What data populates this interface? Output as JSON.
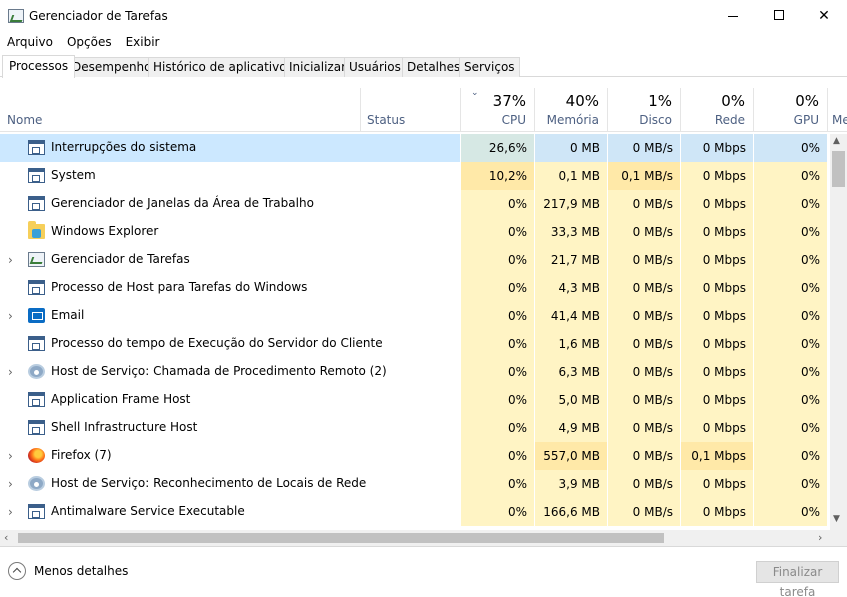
{
  "window": {
    "title": "Gerenciador de Tarefas",
    "min": "—",
    "max": "□",
    "close": "✕"
  },
  "menu": [
    "Arquivo",
    "Opções",
    "Exibir"
  ],
  "tabs": [
    "Processos",
    "Desempenho",
    "Histórico de aplicativos",
    "Inicializar",
    "Usuários",
    "Detalhes",
    "Serviços"
  ],
  "active_tab": "Processos",
  "columns": {
    "name": "Nome",
    "status": "Status",
    "cpu": {
      "pct": "37%",
      "label": "CPU"
    },
    "memory": {
      "pct": "40%",
      "label": "Memória"
    },
    "disk": {
      "pct": "1%",
      "label": "Disco"
    },
    "network": {
      "pct": "0%",
      "label": "Rede"
    },
    "gpu": {
      "pct": "0%",
      "label": "GPU"
    },
    "more": "Me"
  },
  "sort_indicator": "⌄",
  "processes": [
    {
      "name": "Interrupções do sistema",
      "icon": "window-icon",
      "expandable": false,
      "cpu": "26,6%",
      "memory": "0 MB",
      "disk": "0 MB/s",
      "network": "0 Mbps",
      "gpu": "0%"
    },
    {
      "name": "System",
      "icon": "window-icon",
      "expandable": false,
      "cpu": "10,2%",
      "memory": "0,1 MB",
      "disk": "0,1 MB/s",
      "network": "0 Mbps",
      "gpu": "0%"
    },
    {
      "name": "Gerenciador de Janelas da Área de Trabalho",
      "icon": "window-icon",
      "expandable": false,
      "cpu": "0%",
      "memory": "217,9 MB",
      "disk": "0 MB/s",
      "network": "0 Mbps",
      "gpu": "0%"
    },
    {
      "name": "Windows Explorer",
      "icon": "folder-icon",
      "expandable": false,
      "cpu": "0%",
      "memory": "33,3 MB",
      "disk": "0 MB/s",
      "network": "0 Mbps",
      "gpu": "0%"
    },
    {
      "name": "Gerenciador de Tarefas",
      "icon": "task-manager-icon",
      "expandable": true,
      "cpu": "0%",
      "memory": "21,7 MB",
      "disk": "0 MB/s",
      "network": "0 Mbps",
      "gpu": "0%"
    },
    {
      "name": "Processo de Host para Tarefas do Windows",
      "icon": "window-icon",
      "expandable": false,
      "cpu": "0%",
      "memory": "4,3 MB",
      "disk": "0 MB/s",
      "network": "0 Mbps",
      "gpu": "0%"
    },
    {
      "name": "Email",
      "icon": "mail-icon",
      "expandable": true,
      "cpu": "0%",
      "memory": "41,4 MB",
      "disk": "0 MB/s",
      "network": "0 Mbps",
      "gpu": "0%"
    },
    {
      "name": "Processo do tempo de Execução do Servidor do Cliente",
      "icon": "window-icon",
      "expandable": false,
      "cpu": "0%",
      "memory": "1,6 MB",
      "disk": "0 MB/s",
      "network": "0 Mbps",
      "gpu": "0%"
    },
    {
      "name": "Host de Serviço: Chamada de Procedimento Remoto (2)",
      "icon": "gear-icon",
      "expandable": true,
      "cpu": "0%",
      "memory": "6,3 MB",
      "disk": "0 MB/s",
      "network": "0 Mbps",
      "gpu": "0%"
    },
    {
      "name": "Application Frame Host",
      "icon": "window-icon",
      "expandable": false,
      "cpu": "0%",
      "memory": "5,0 MB",
      "disk": "0 MB/s",
      "network": "0 Mbps",
      "gpu": "0%"
    },
    {
      "name": "Shell Infrastructure Host",
      "icon": "window-icon",
      "expandable": false,
      "cpu": "0%",
      "memory": "4,9 MB",
      "disk": "0 MB/s",
      "network": "0 Mbps",
      "gpu": "0%"
    },
    {
      "name": "Firefox (7)",
      "icon": "firefox-icon",
      "expandable": true,
      "cpu": "0%",
      "memory": "557,0 MB",
      "disk": "0 MB/s",
      "network": "0,1 Mbps",
      "gpu": "0%"
    },
    {
      "name": "Host de Serviço: Reconhecimento de Locais de Rede",
      "icon": "gear-icon",
      "expandable": true,
      "cpu": "0%",
      "memory": "3,9 MB",
      "disk": "0 MB/s",
      "network": "0 Mbps",
      "gpu": "0%"
    },
    {
      "name": "Antimalware Service Executable",
      "icon": "window-icon",
      "expandable": true,
      "cpu": "0%",
      "memory": "166,6 MB",
      "disk": "0 MB/s",
      "network": "0 Mbps",
      "gpu": "0%"
    }
  ],
  "colors": {
    "selected_row": "#cce8ff",
    "heat_light": "#fff4c4",
    "heat_medium": "#ffe9a8",
    "heat_high": "#ffd88a",
    "header_blue_text": "#4d6082"
  },
  "footer": {
    "less_details": "Menos detalhes",
    "end_task": "Finalizar tarefa"
  }
}
